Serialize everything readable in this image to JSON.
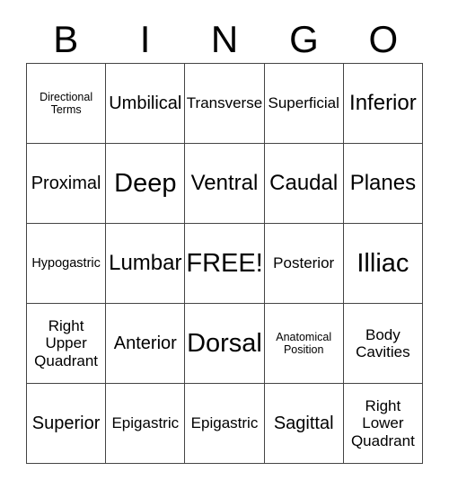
{
  "card": {
    "header_letters": [
      "B",
      "I",
      "N",
      "G",
      "O"
    ],
    "columns": 5,
    "rows": 5,
    "grid_border_color": "#444444",
    "text_color": "#000000",
    "background_color": "#ffffff",
    "free_space_label": "FREE!",
    "cells": [
      [
        {
          "label": "Directional\nTerms",
          "size": "xs"
        },
        {
          "label": "Umbilical",
          "size": "lg"
        },
        {
          "label": "Transverse",
          "size": "md"
        },
        {
          "label": "Superficial",
          "size": "md"
        },
        {
          "label": "Inferior",
          "size": "xl"
        }
      ],
      [
        {
          "label": "Proximal",
          "size": "lg"
        },
        {
          "label": "Deep",
          "size": "xxl"
        },
        {
          "label": "Ventral",
          "size": "xl"
        },
        {
          "label": "Caudal",
          "size": "xl"
        },
        {
          "label": "Planes",
          "size": "xl"
        }
      ],
      [
        {
          "label": "Hypogastric",
          "size": "sm"
        },
        {
          "label": "Lumbar",
          "size": "xl"
        },
        {
          "label": "FREE!",
          "size": "xxl"
        },
        {
          "label": "Posterior",
          "size": "md"
        },
        {
          "label": "Illiac",
          "size": "xxl"
        }
      ],
      [
        {
          "label": "Right\nUpper\nQuadrant",
          "size": "md"
        },
        {
          "label": "Anterior",
          "size": "lg"
        },
        {
          "label": "Dorsal",
          "size": "xxl"
        },
        {
          "label": "Anatomical\nPosition",
          "size": "xs"
        },
        {
          "label": "Body\nCavities",
          "size": "md"
        }
      ],
      [
        {
          "label": "Superior",
          "size": "lg"
        },
        {
          "label": "Epigastric",
          "size": "md"
        },
        {
          "label": "Epigastric",
          "size": "md"
        },
        {
          "label": "Sagittal",
          "size": "lg"
        },
        {
          "label": "Right\nLower\nQuadrant",
          "size": "md"
        }
      ]
    ]
  }
}
